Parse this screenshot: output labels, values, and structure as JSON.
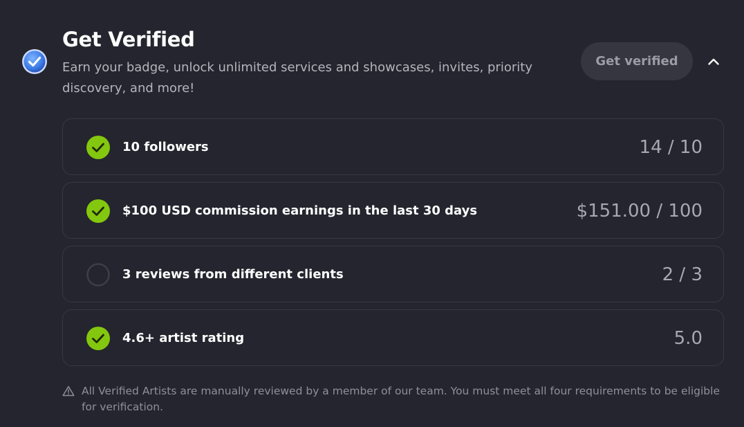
{
  "header": {
    "title": "Get Verified",
    "subtitle": "Earn your badge, unlock unlimited services and showcases, invites, priority discovery, and more!",
    "verify_button_label": "Get verified",
    "collapse_icon": "chevron-up-icon",
    "badge_icon": "verified-badge-icon"
  },
  "requirements": [
    {
      "label": "10 followers",
      "value": "14 / 10",
      "met": true
    },
    {
      "label": "$100 USD commission earnings in the last 30 days",
      "value": "$151.00 / 100",
      "met": true
    },
    {
      "label": "3 reviews from different clients",
      "value": "2 / 3",
      "met": false
    },
    {
      "label": "4.6+ artist rating",
      "value": "5.0",
      "met": true
    }
  ],
  "footnote": {
    "icon": "warning-icon",
    "text": "All Verified Artists are manually reviewed by a member of our team. You must meet all four requirements to be eligible for verification."
  },
  "colors": {
    "background": "#24252e",
    "check_green": "#84c70f",
    "badge_blue": "#3f7ee8",
    "row_border": "#383944",
    "button_bg": "#353640"
  }
}
